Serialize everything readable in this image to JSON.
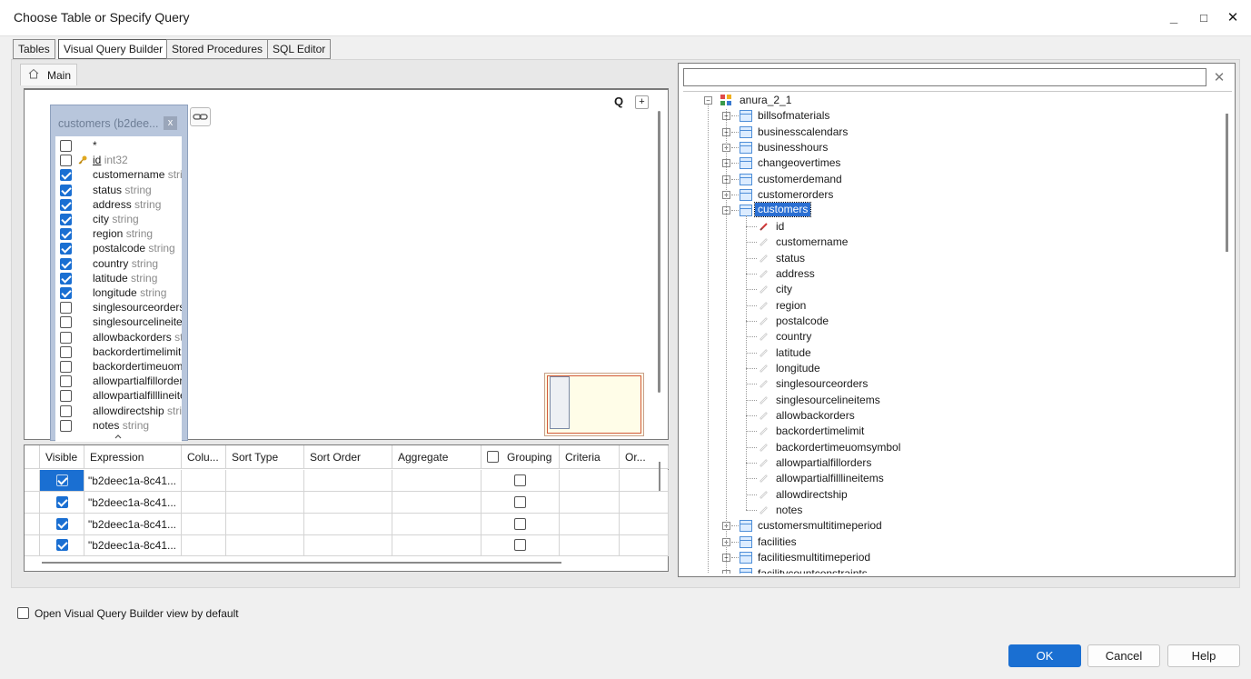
{
  "window": {
    "title": "Choose Table or Specify Query",
    "minimize": "_",
    "maximize": "□",
    "close": "✕"
  },
  "tabs": [
    "Tables",
    "Visual Query Builder",
    "Stored Procedures",
    "SQL Editor"
  ],
  "active_tab": "Visual Query Builder",
  "subtab": {
    "label": "Main"
  },
  "canvas": {
    "q_button": "Q",
    "plus_button": "+",
    "table_box": {
      "title": "customers (b2dee...",
      "close": "x",
      "fields": [
        {
          "name": "*",
          "type": "",
          "checked": false,
          "key": false
        },
        {
          "name": "id",
          "type": "int32",
          "checked": false,
          "key": true
        },
        {
          "name": "customername",
          "type": "stri",
          "checked": true,
          "key": false
        },
        {
          "name": "status",
          "type": "string",
          "checked": true,
          "key": false
        },
        {
          "name": "address",
          "type": "string",
          "checked": true,
          "key": false
        },
        {
          "name": "city",
          "type": "string",
          "checked": true,
          "key": false
        },
        {
          "name": "region",
          "type": "string",
          "checked": true,
          "key": false
        },
        {
          "name": "postalcode",
          "type": "string",
          "checked": true,
          "key": false
        },
        {
          "name": "country",
          "type": "string",
          "checked": true,
          "key": false
        },
        {
          "name": "latitude",
          "type": "string",
          "checked": true,
          "key": false
        },
        {
          "name": "longitude",
          "type": "string",
          "checked": true,
          "key": false
        },
        {
          "name": "singlesourceorders",
          "type": "",
          "checked": false,
          "key": false
        },
        {
          "name": "singlesourcelineiter",
          "type": "",
          "checked": false,
          "key": false
        },
        {
          "name": "allowbackorders",
          "type": "st",
          "checked": false,
          "key": false
        },
        {
          "name": "backordertimelimit",
          "type": "",
          "checked": false,
          "key": false
        },
        {
          "name": "backordertimeuoms",
          "type": "",
          "checked": false,
          "key": false
        },
        {
          "name": "allowpartialfillorders",
          "type": "",
          "checked": false,
          "key": false
        },
        {
          "name": "allowpartialfilllineite",
          "type": "",
          "checked": false,
          "key": false
        },
        {
          "name": "allowdirectship",
          "type": "stri",
          "checked": false,
          "key": false
        },
        {
          "name": "notes",
          "type": "string",
          "checked": false,
          "key": false
        }
      ]
    }
  },
  "grid": {
    "columns": [
      "Visible",
      "Expression",
      "Colu...",
      "Sort Type",
      "Sort Order",
      "Aggregate",
      "Grouping",
      "Criteria",
      "Or..."
    ],
    "rows": [
      {
        "visible": true,
        "expression": "\"b2deec1a-8c41...",
        "grouping": false
      },
      {
        "visible": true,
        "expression": "\"b2deec1a-8c41...",
        "grouping": false
      },
      {
        "visible": true,
        "expression": "\"b2deec1a-8c41...",
        "grouping": false
      },
      {
        "visible": true,
        "expression": "\"b2deec1a-8c41...",
        "grouping": false
      }
    ]
  },
  "tree": {
    "search_value": "",
    "clear": "✕",
    "root": "anura_2_1",
    "tables_before": [
      "billsofmaterials",
      "businesscalendars",
      "businesshours",
      "changeovertimes",
      "customerdemand",
      "customerorders"
    ],
    "selected_table": "customers",
    "columns": [
      "id",
      "customername",
      "status",
      "address",
      "city",
      "region",
      "postalcode",
      "country",
      "latitude",
      "longitude",
      "singlesourceorders",
      "singlesourcelineitems",
      "allowbackorders",
      "backordertimelimit",
      "backordertimeuomsymbol",
      "allowpartialfillorders",
      "allowpartialfilllineitems",
      "allowdirectship",
      "notes"
    ],
    "tables_after": [
      "customersmultitimeperiod",
      "facilities",
      "facilitiesmultitimeperiod",
      "facilitycountconstraints"
    ]
  },
  "footer": {
    "default_view_label": "Open Visual Query Builder view by default",
    "default_view_checked": false,
    "ok": "OK",
    "cancel": "Cancel",
    "help": "Help"
  },
  "colors": {
    "accent": "#1a6fd2",
    "table_box_bg": "#b8c6dc"
  }
}
